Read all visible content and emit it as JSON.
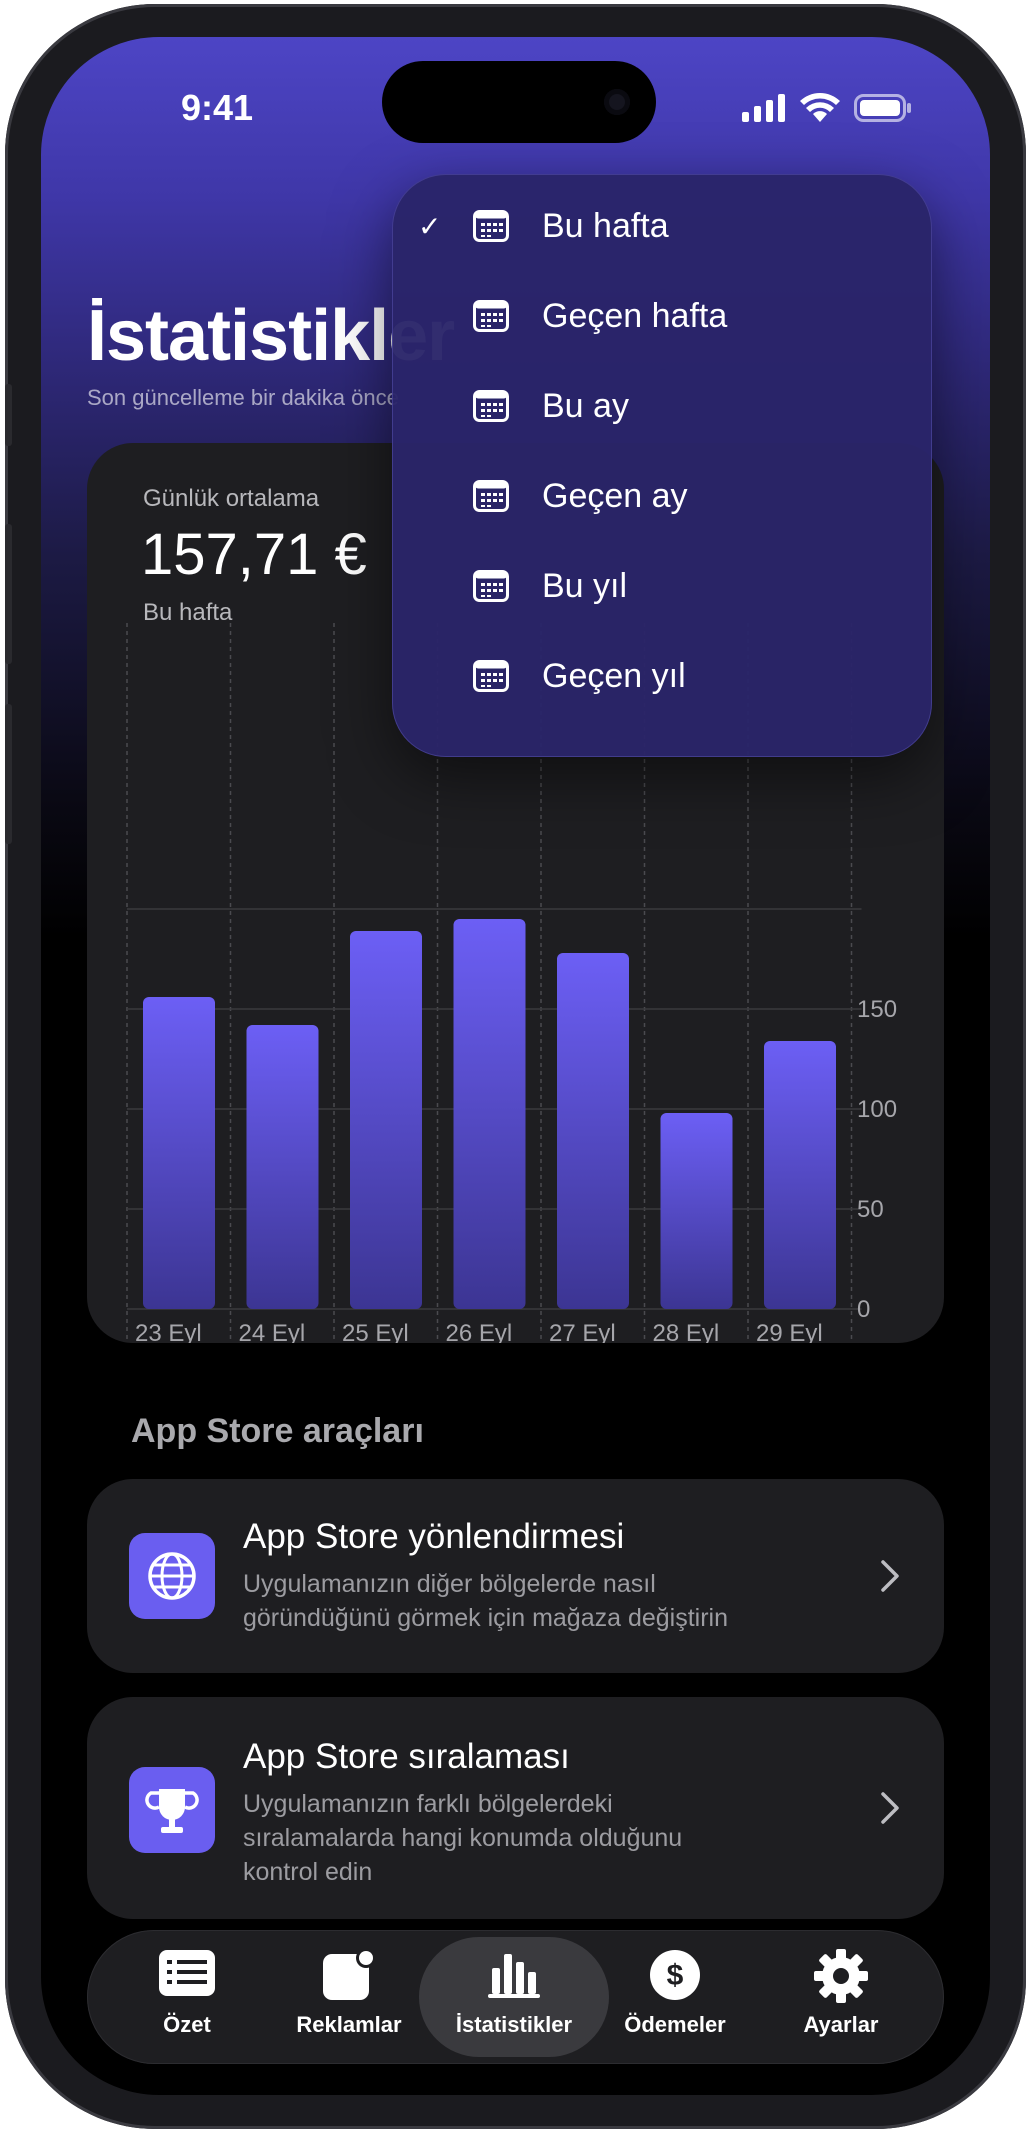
{
  "status": {
    "time": "9:41"
  },
  "header": {
    "title": "İstatistikler",
    "subtitle": "Son güncelleme bir dakika önce"
  },
  "stats_card": {
    "label": "Günlük ortalama",
    "value": "157,71 €",
    "period": "Bu hafta"
  },
  "chart_data": {
    "type": "bar",
    "categories": [
      "23 Eyl",
      "24 Eyl",
      "25 Eyl",
      "26 Eyl",
      "27 Eyl",
      "28 Eyl",
      "29 Eyl"
    ],
    "values": [
      156,
      142,
      189,
      195,
      178,
      98,
      134
    ],
    "y_ticks": [
      "0",
      "50",
      "100",
      "150"
    ],
    "ylim": [
      0,
      200
    ],
    "bar_color_top": "#6c5ff5",
    "bar_color_bottom": "#3c3593",
    "grid": true
  },
  "period_menu": {
    "items": [
      {
        "label": "Bu hafta",
        "selected": true
      },
      {
        "label": "Geçen hafta",
        "selected": false
      },
      {
        "label": "Bu ay",
        "selected": false
      },
      {
        "label": "Geçen ay",
        "selected": false
      },
      {
        "label": "Bu yıl",
        "selected": false
      },
      {
        "label": "Geçen yıl",
        "selected": false
      }
    ],
    "check_glyph": "✓",
    "icon": "calendar-icon"
  },
  "tools": {
    "section_title": "App Store araçları",
    "items": [
      {
        "title": "App Store yönlendirmesi",
        "description": "Uygulamanızın diğer bölgelerde nasıl göründüğünü görmek için mağaza değiştirin",
        "icon": "globe-icon"
      },
      {
        "title": "App Store sıralaması",
        "description": "Uygulamanızın farklı bölgelerdeki sıralamalarda hangi konumda olduğunu kontrol edin",
        "icon": "trophy-icon"
      }
    ]
  },
  "tabbar": {
    "items": [
      {
        "label": "Özet",
        "icon": "list-icon"
      },
      {
        "label": "Reklamlar",
        "icon": "ads-icon"
      },
      {
        "label": "İstatistikler",
        "icon": "bar-chart-icon",
        "active": true
      },
      {
        "label": "Ödemeler",
        "icon": "dollar-icon"
      },
      {
        "label": "Ayarlar",
        "icon": "gear-icon"
      }
    ]
  },
  "colors": {
    "accent": "#6a5ef0",
    "card": "#1e1e21",
    "gradient_top": "#4d45c5"
  }
}
